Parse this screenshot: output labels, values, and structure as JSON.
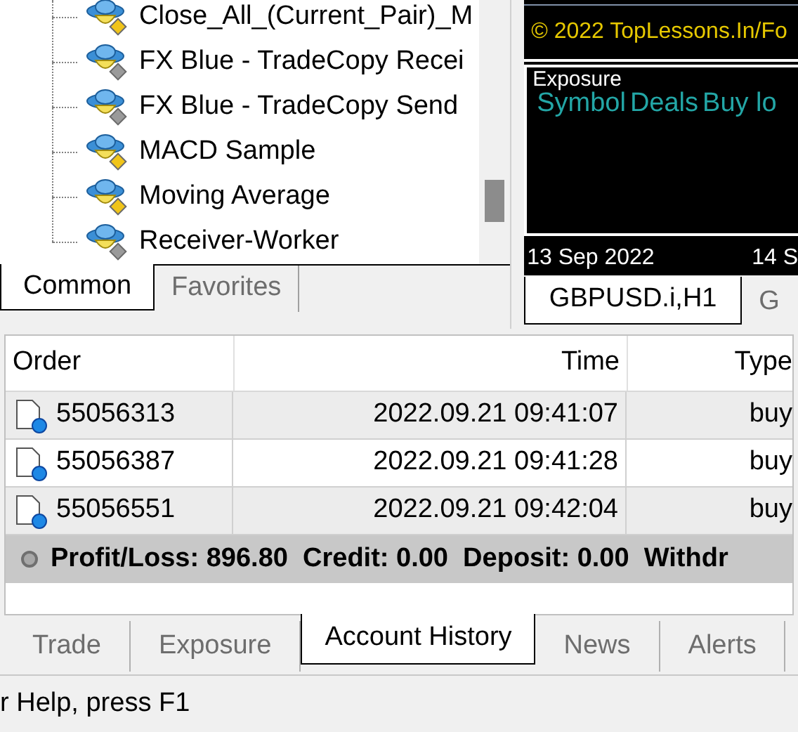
{
  "navigator": {
    "items": [
      {
        "label": "Close_All_(Current_Pair)_M",
        "kind": "active"
      },
      {
        "label": "FX Blue - TradeCopy Recei",
        "kind": "inactive"
      },
      {
        "label": "FX Blue - TradeCopy Send",
        "kind": "inactive"
      },
      {
        "label": "MACD Sample",
        "kind": "active"
      },
      {
        "label": "Moving Average",
        "kind": "active"
      },
      {
        "label": "Receiver-Worker",
        "kind": "inactive"
      }
    ],
    "tabs": [
      {
        "label": "Common",
        "selected": true
      },
      {
        "label": "Favorites",
        "selected": false
      }
    ]
  },
  "chart": {
    "copyright": "© 2022 TopLessons.In/Fo",
    "indicator": {
      "title": "Exposure",
      "columns": [
        "Symbol",
        "Deals",
        "Buy lo"
      ]
    },
    "dates": [
      "13 Sep 2022",
      "14 S"
    ],
    "tabs": [
      {
        "label": "GBPUSD.i,H1",
        "selected": true
      },
      {
        "label": "G",
        "selected": false
      }
    ]
  },
  "terminal": {
    "table": {
      "columns": [
        "Order",
        "Time",
        "Type"
      ],
      "rows": [
        {
          "order": "55056313",
          "time": "2022.09.21 09:41:07",
          "type": "buy"
        },
        {
          "order": "55056387",
          "time": "2022.09.21 09:41:28",
          "type": "buy"
        },
        {
          "order": "55056551",
          "time": "2022.09.21 09:42:04",
          "type": "buy"
        }
      ]
    },
    "summary": "Profit/Loss: 896.80  Credit: 0.00  Deposit: 0.00  Withdr",
    "tabs": [
      {
        "label": "Trade",
        "selected": false
      },
      {
        "label": "Exposure",
        "selected": false
      },
      {
        "label": "Account History",
        "selected": true
      },
      {
        "label": "News",
        "selected": false
      },
      {
        "label": "Alerts",
        "selected": false
      }
    ]
  },
  "status_bar": {
    "text": "r Help, press F1"
  }
}
